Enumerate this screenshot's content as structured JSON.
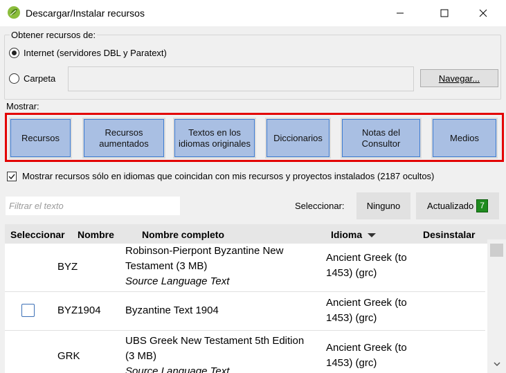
{
  "window": {
    "title": "Descargar/Instalar recursos",
    "icon": "paratext-leaf-icon",
    "controls": [
      "minimize-icon",
      "maximize-icon",
      "close-icon"
    ]
  },
  "source": {
    "legend": "Obtener recursos de:",
    "internet_label": "Internet (servidores DBL y Paratext)",
    "internet_selected": true,
    "folder_label": "Carpeta",
    "folder_value": "",
    "browse_label": "Navegar..."
  },
  "show": {
    "label": "Mostrar:",
    "buttons": [
      {
        "label": "Recursos"
      },
      {
        "label": "Recursos aumentados"
      },
      {
        "label": "Textos en los idiomas originales"
      },
      {
        "label": "Diccionarios"
      },
      {
        "label": "Notas del Consultor"
      },
      {
        "label": "Medios"
      }
    ]
  },
  "filter_languages": {
    "checked": true,
    "label": "Mostrar recursos sólo en idiomas que coincidan con mis recursos y proyectos instalados (2187 ocultos)"
  },
  "filter": {
    "placeholder": "Filtrar el texto"
  },
  "selection": {
    "label": "Seleccionar:",
    "none_label": "Ninguno",
    "updated_label": "Actualizado",
    "updated_count": "7"
  },
  "table": {
    "columns": [
      "Seleccionar",
      "Nombre",
      "Nombre completo",
      "Idioma",
      "Desinstalar"
    ],
    "sort_column": "Idioma",
    "rows": [
      {
        "name": "BYZ",
        "full_name": "Robinson-Pierpont Byzantine New Testament (3 MB)",
        "description": "Source Language Text",
        "language": "Ancient Greek (to 1453) (grc)",
        "has_checkbox": false
      },
      {
        "name": "BYZ1904",
        "full_name": "Byzantine Text 1904",
        "description": "",
        "language": "Ancient Greek (to 1453) (grc)",
        "has_checkbox": true
      },
      {
        "name": "GRK",
        "full_name": "UBS Greek New Testament 5th Edition (3 MB)",
        "description": "Source Language Text",
        "language": "Ancient Greek (to 1453) (grc)",
        "has_checkbox": false
      }
    ]
  },
  "colors": {
    "highlight_border": "#e30000",
    "show_button_fill": "#a9bfe3",
    "show_button_border": "#3c7bd2",
    "badge_green": "#1f8b1f"
  }
}
